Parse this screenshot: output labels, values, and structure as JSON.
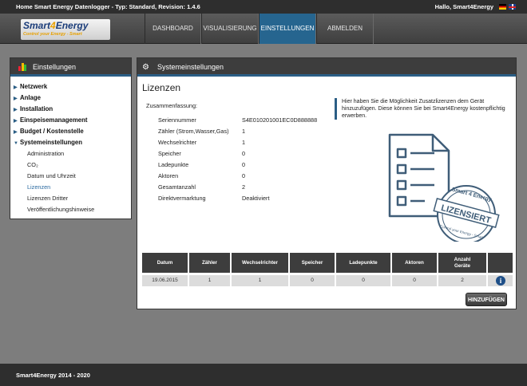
{
  "topbar": {
    "app_title": "Home Smart Energy Datenlogger - Typ: Standard, Revision: 1.4.6",
    "greeting": "Hallo,  Smart4Energy"
  },
  "logo": {
    "name_pre": "Smart",
    "name_num": "4",
    "name_post": "Energy",
    "tagline": "Control your Energy - Smart"
  },
  "nav": {
    "items": [
      {
        "label": "DASHBOARD"
      },
      {
        "label": "VISUALISIERUNG"
      },
      {
        "label": "EINSTELLUNGEN"
      },
      {
        "label": "ABMELDEN"
      }
    ]
  },
  "sidebar": {
    "title": "Einstellungen",
    "items": [
      {
        "label": "Netzwerk",
        "arrow": "▶"
      },
      {
        "label": "Anlage",
        "arrow": "▶"
      },
      {
        "label": "Installation",
        "arrow": "▶"
      },
      {
        "label": "Einspeisemanagement",
        "arrow": "▶"
      },
      {
        "label": "Budget / Kostenstelle",
        "arrow": "▶"
      },
      {
        "label": "Systemeinstellungen",
        "arrow": "▼"
      }
    ],
    "subitems": [
      {
        "label": "Administration"
      },
      {
        "label": "CO₂"
      },
      {
        "label": "Datum und Uhrzeit"
      },
      {
        "label": "Lizenzen"
      },
      {
        "label": "Lizenzen Dritter"
      },
      {
        "label": "Veröffentlichungshinweise"
      }
    ]
  },
  "panel": {
    "title": "Systemeinstellungen",
    "heading": "Lizenzen",
    "summary_label": "Zusammenfassung:",
    "summary": [
      {
        "label": "Seriennummer",
        "value": "S4E010201001EC0D888888"
      },
      {
        "label": "Zähler (Strom,Wasser,Gas)",
        "value": "1"
      },
      {
        "label": "Wechselrichter",
        "value": "1"
      },
      {
        "label": "Speicher",
        "value": "0"
      },
      {
        "label": "Ladepunkte",
        "value": "0"
      },
      {
        "label": "Aktoren",
        "value": "0"
      },
      {
        "label": "Gesamtanzahl",
        "value": "2"
      },
      {
        "label": "Direktvermarktung",
        "value": "Deaktiviert"
      }
    ],
    "hint": "Hier haben Sie die Möglichkeit Zusatzlizenzen dem Gerät hinzuzufügen. Diese können Sie bei Smart4Energy kostenpflichtig erwerben.",
    "stamp": {
      "word": "LIZENSIERT",
      "ring_top": "Smart 4 Energy",
      "ring_bottom": "Control your Energy - Smart"
    },
    "table": {
      "headers": [
        "Datum",
        "Zähler",
        "Wechselrichter",
        "Speicher",
        "Ladepunkte",
        "Aktoren",
        "Anzahl Geräte"
      ],
      "row": [
        "19.06.2015",
        "1",
        "1",
        "0",
        "0",
        "0",
        "2"
      ]
    },
    "add_button": "HINZUFÜGEN"
  },
  "footer": {
    "text": "Smart4Energy 2014 - 2020"
  }
}
